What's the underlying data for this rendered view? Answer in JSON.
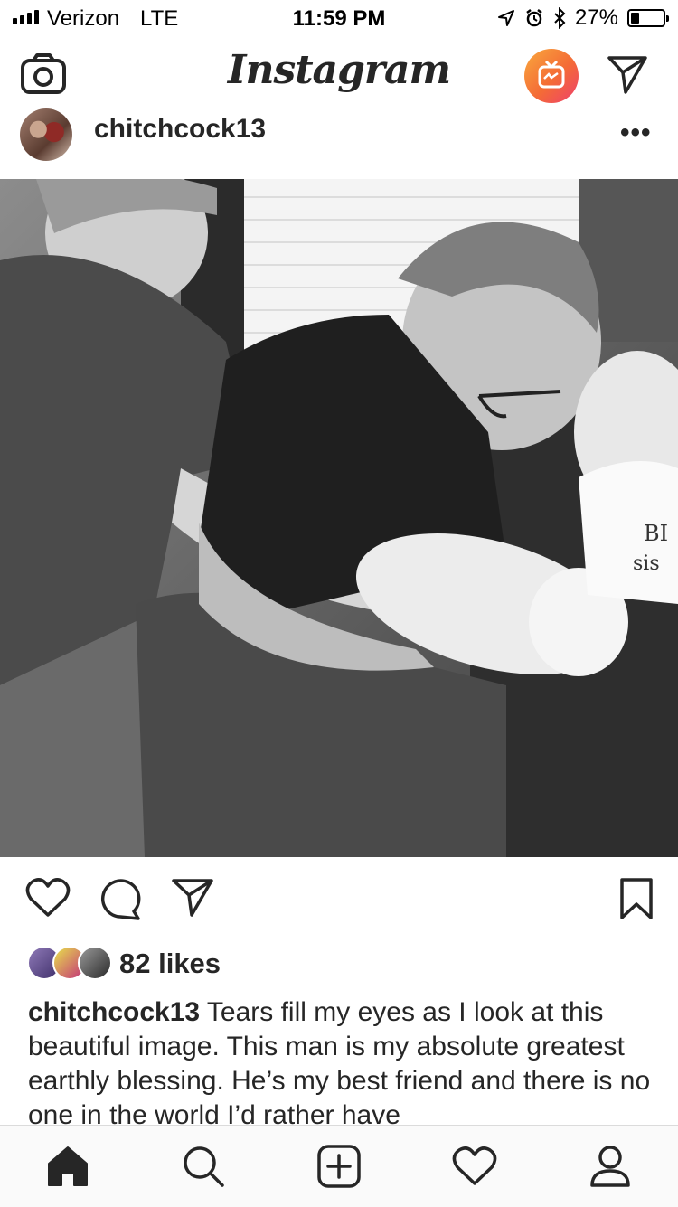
{
  "status_bar": {
    "carrier": "Verizon",
    "network": "LTE",
    "time": "11:59 PM",
    "battery": "27%",
    "battery_level": 0.27
  },
  "header": {
    "title": "Instagram",
    "icons": [
      "camera-icon",
      "igtv-icon",
      "direct-message-icon"
    ],
    "igtv_gradient": [
      "#f9a93d",
      "#ee3f6d"
    ]
  },
  "post": {
    "username": "chitchcock13",
    "more_label": "•••",
    "likes": "82 likes",
    "caption_username": "chitchcock13",
    "caption_text": "Tears fill my eyes as I look at this beautiful image. This man is my absolute greatest earthly blessing. He’s my best friend and there is no one in the world I’d rather have"
  },
  "tab_bar": {
    "items": [
      "home-icon",
      "search-icon",
      "new-post-icon",
      "activity-icon",
      "profile-icon"
    ]
  }
}
